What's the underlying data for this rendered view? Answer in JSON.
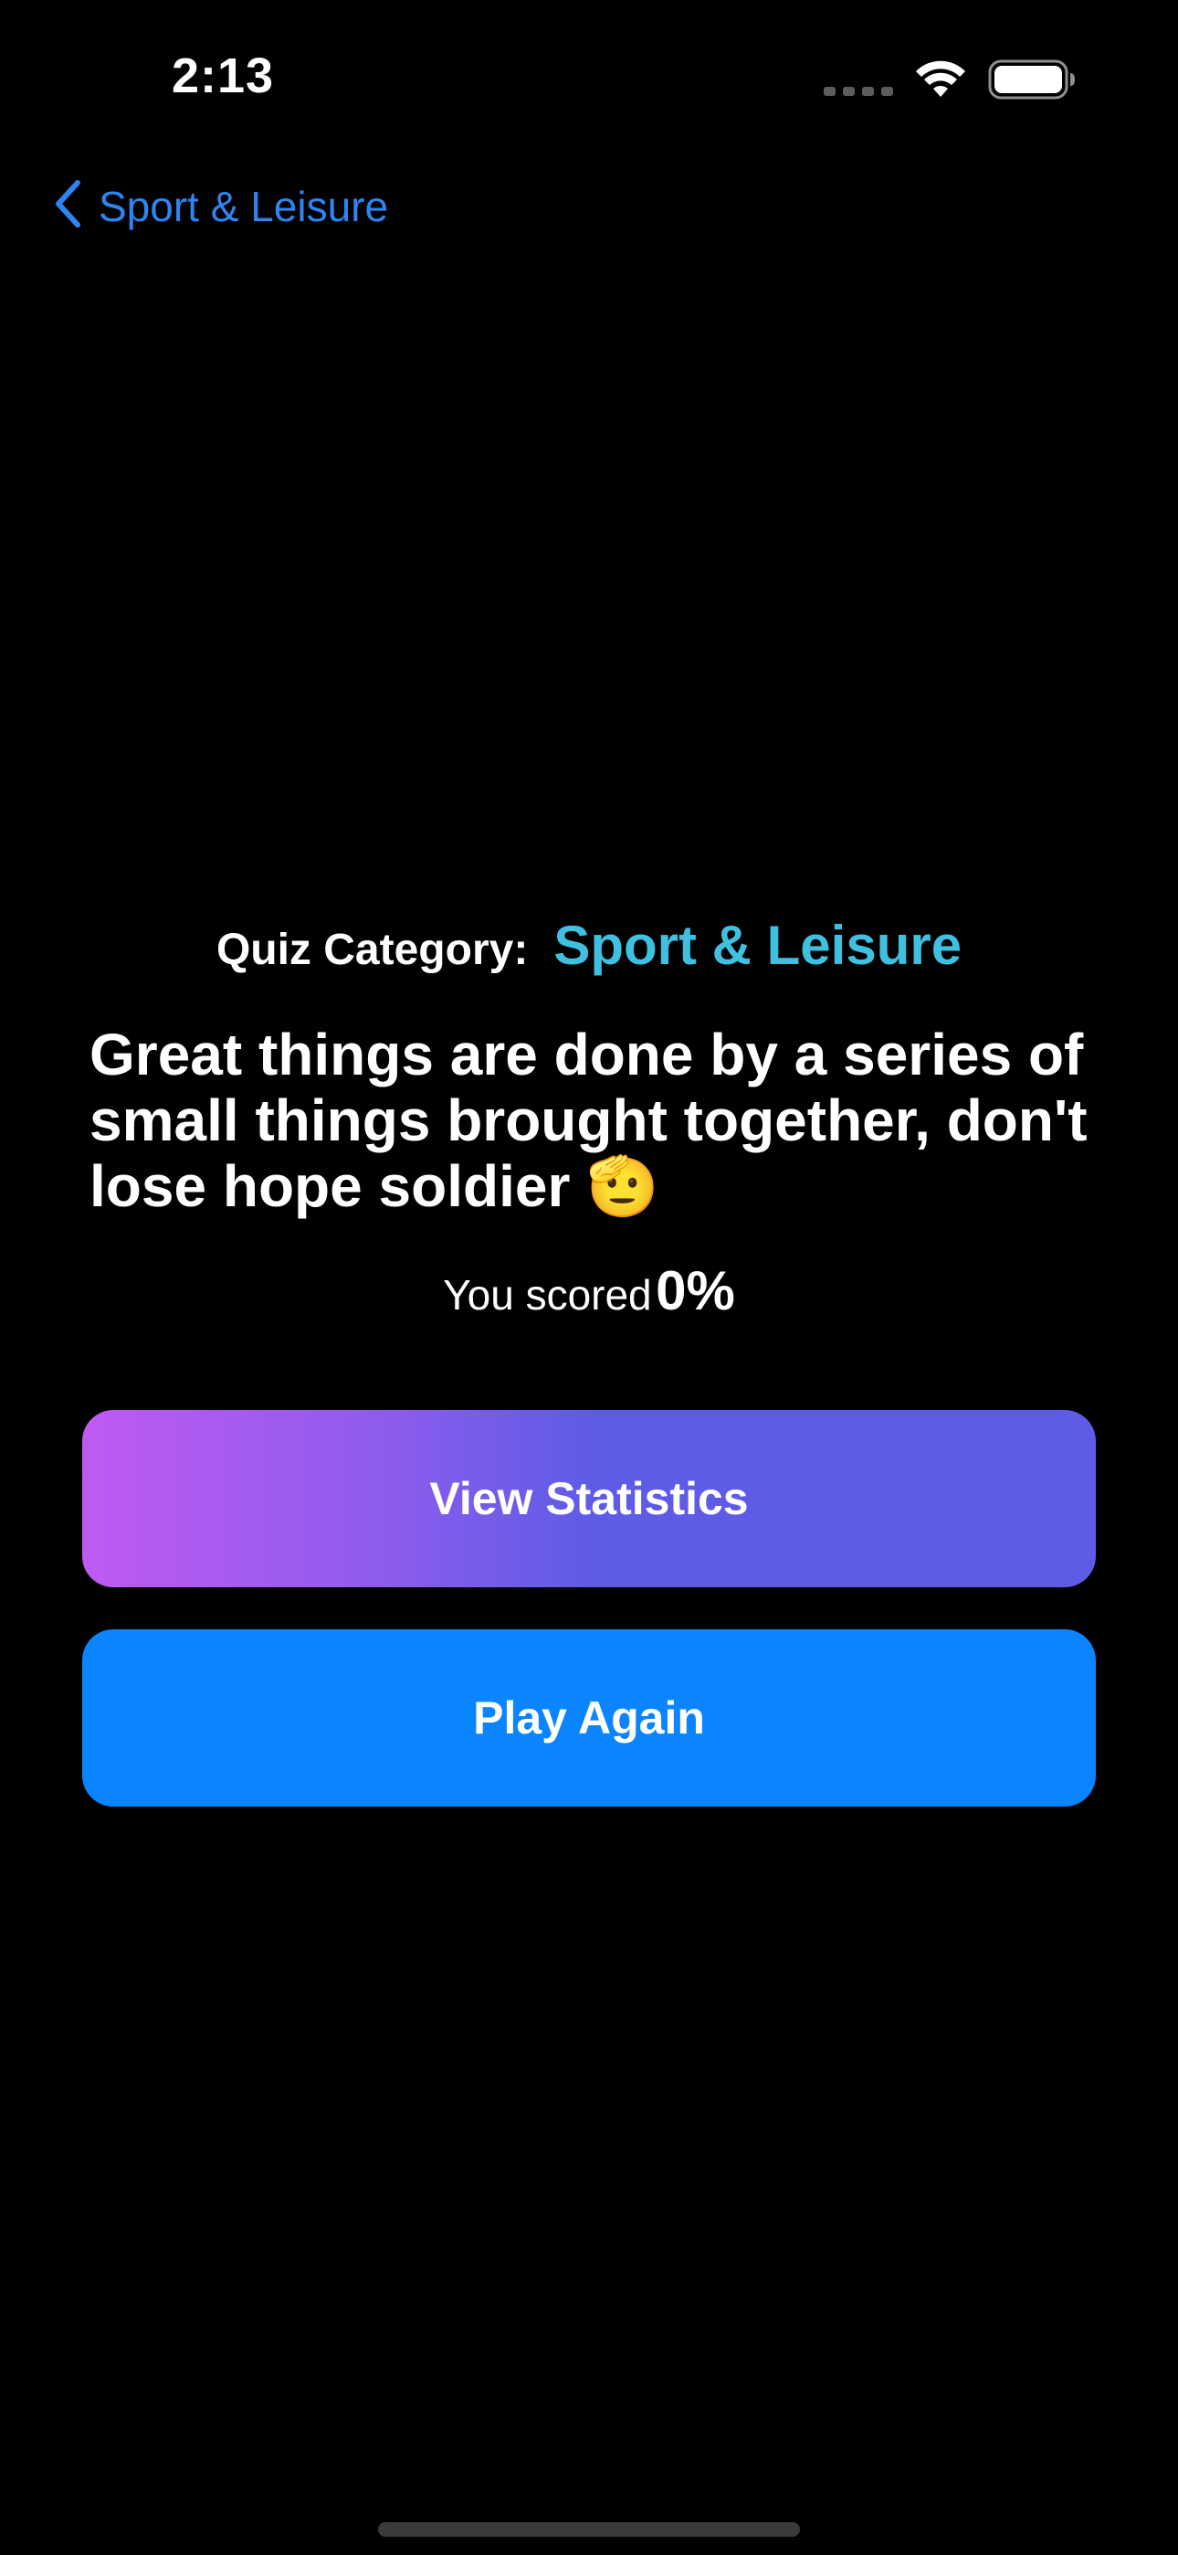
{
  "status_bar": {
    "time": "2:13",
    "icons": [
      "cellular-icon",
      "wifi-icon",
      "battery-icon"
    ]
  },
  "nav": {
    "back_label": "Sport & Leisure",
    "back_icon": "chevron-left-icon"
  },
  "result": {
    "category_label": "Quiz Category:",
    "category_value": "Sport & Leisure",
    "message": "Great things are done by a series of small things brought together, don't lose hope soldier 🫡",
    "score_label": "You scored",
    "score_value": "0%"
  },
  "buttons": {
    "view_statistics": "View Statistics",
    "play_again": "Play Again"
  },
  "colors": {
    "background": "#000000",
    "link_blue": "#2e84f0",
    "category_cyan": "#3fc0e0",
    "gradient_start": "#bf5af2",
    "gradient_end": "#5e5ce6",
    "play_blue": "#0a84ff"
  }
}
